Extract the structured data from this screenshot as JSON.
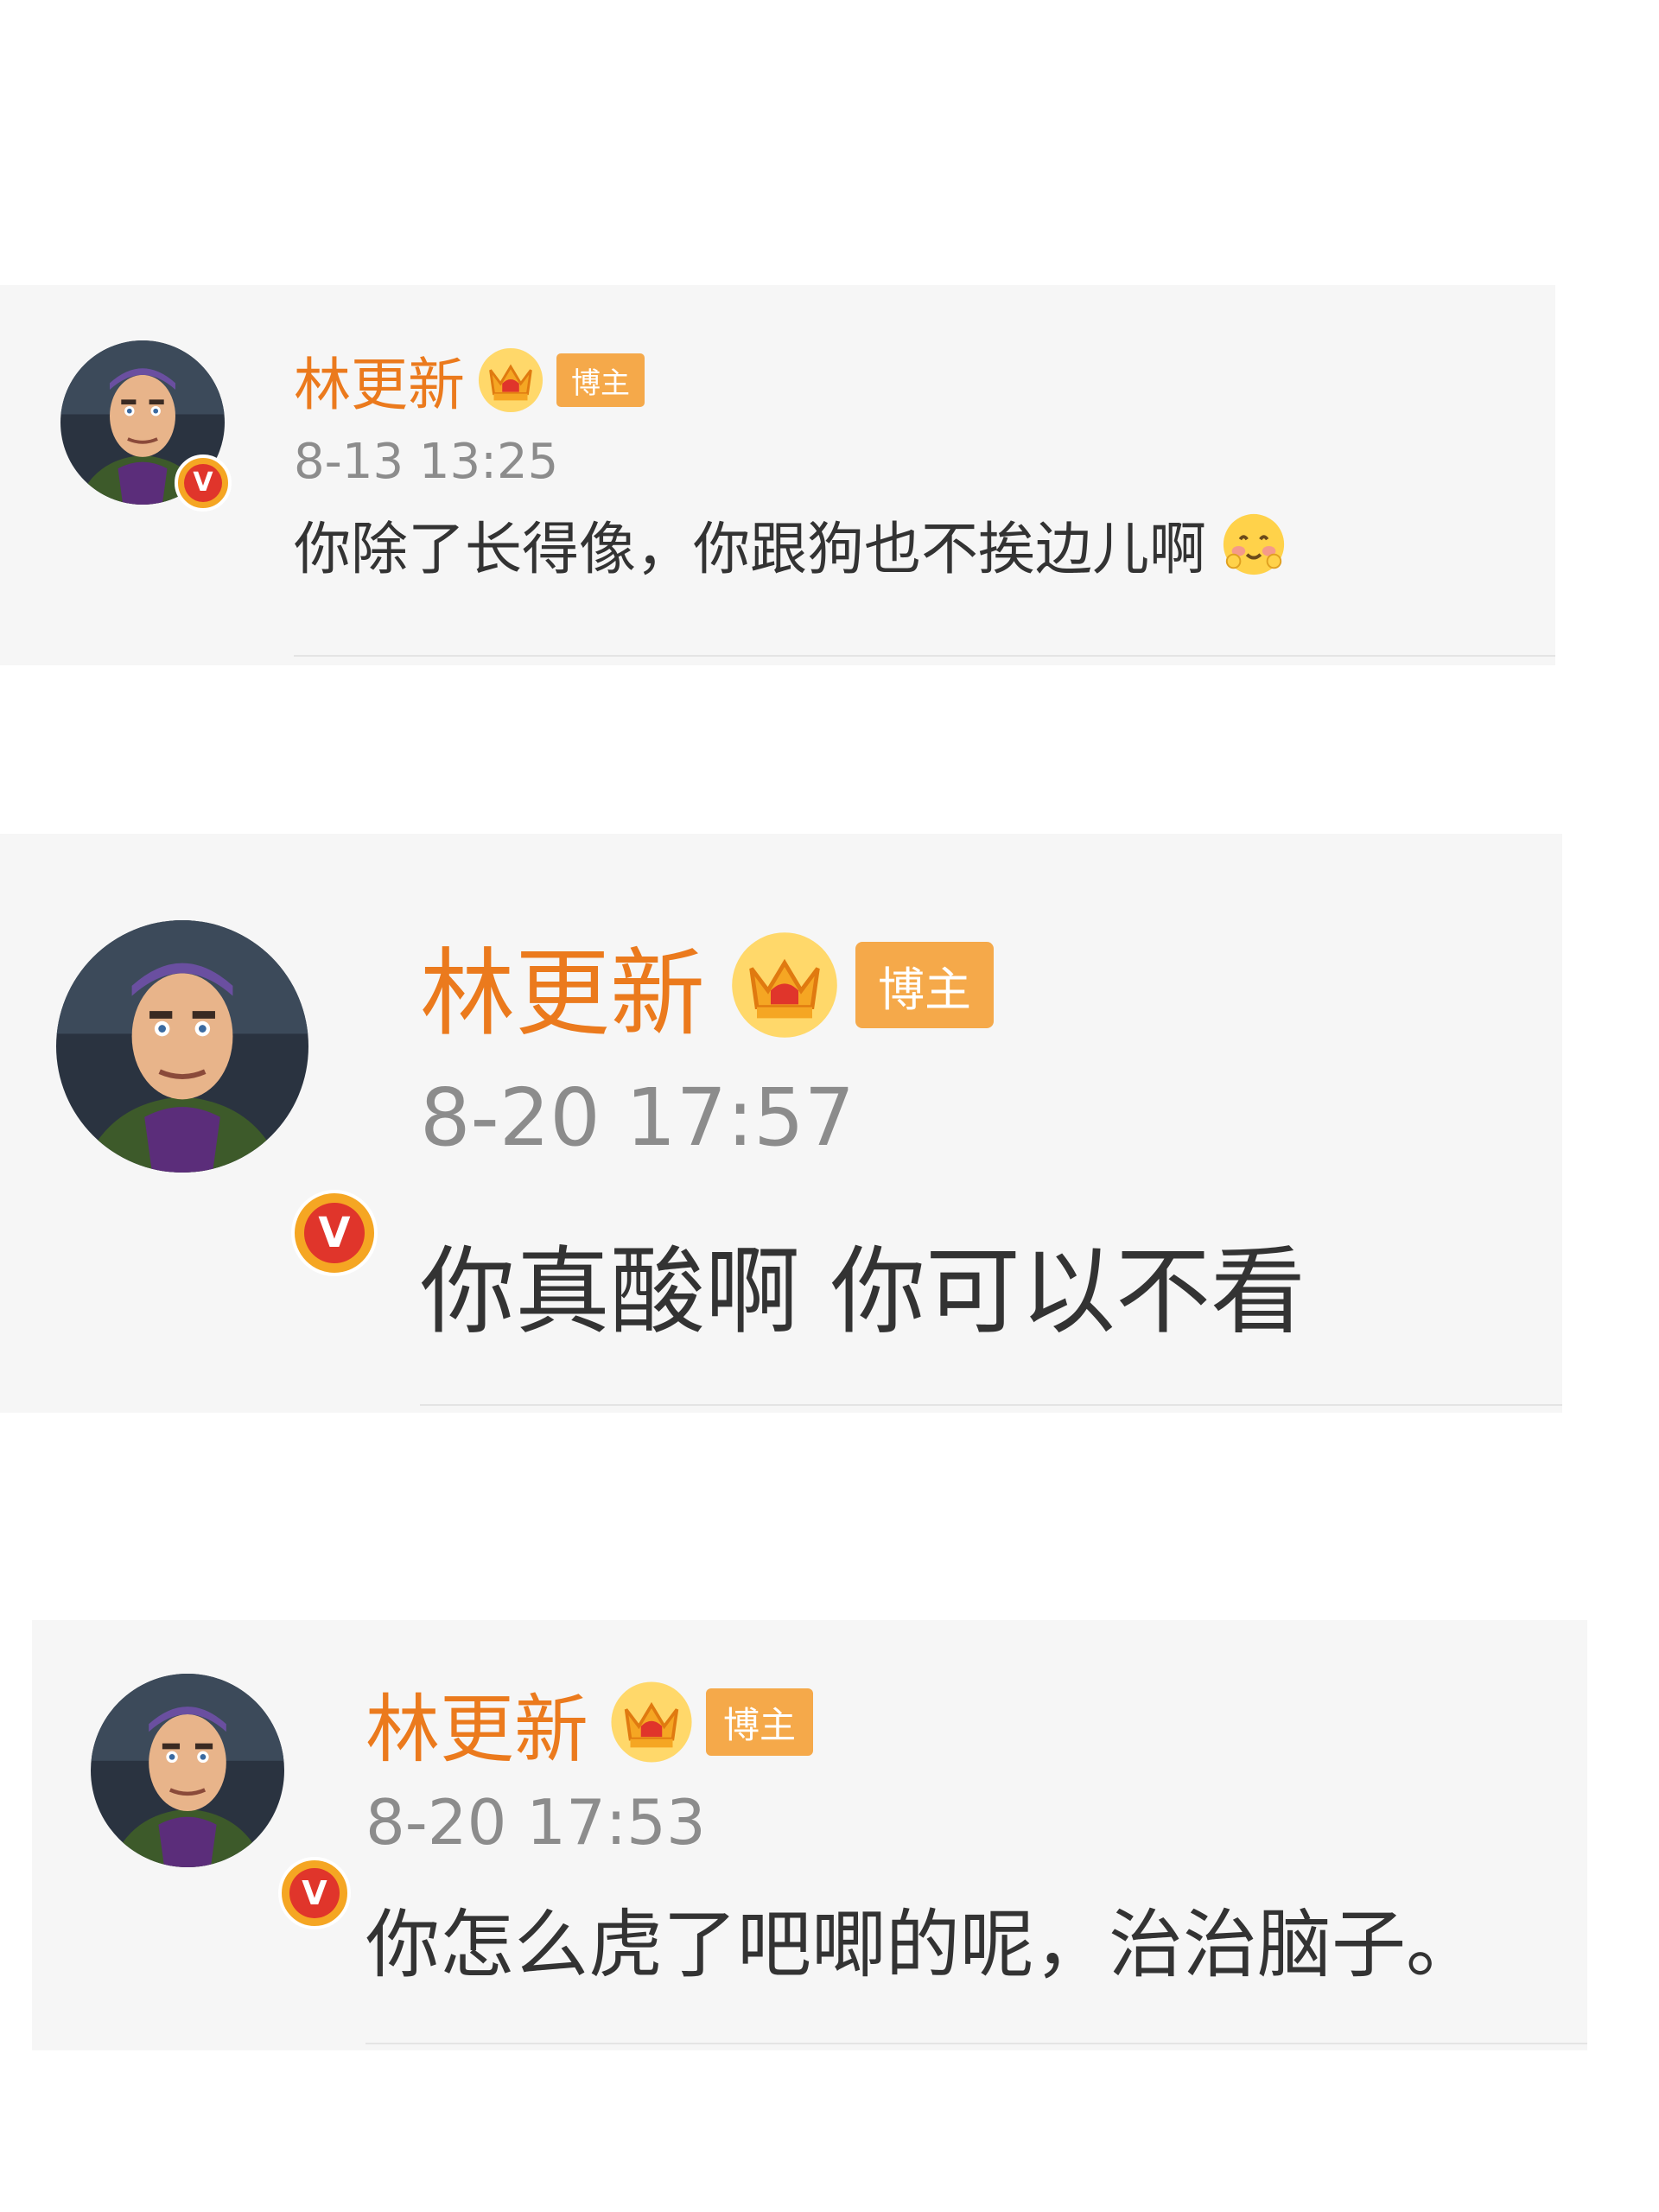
{
  "colors": {
    "card_background": "#f6f6f6",
    "username": "#eb7a1d",
    "tag_background": "#f5a94a",
    "timestamp": "#8c8c8c",
    "comment_text": "#333333",
    "verified_badge": "#e0352b"
  },
  "comments": [
    {
      "username": "林更新",
      "badge_icon": "crown-icon",
      "tag": "博主",
      "verified_mark": "V",
      "timestamp": "8-13 13:25",
      "text": "你除了长得像，你跟狗也不挨边儿啊",
      "emoji": "blushing-face-emoji"
    },
    {
      "username": "林更新",
      "badge_icon": "crown-icon",
      "tag": "博主",
      "verified_mark": "V",
      "timestamp": "8-20 17:57",
      "text": "你真酸啊 你可以不看"
    },
    {
      "username": "林更新",
      "badge_icon": "crown-icon",
      "tag": "博主",
      "verified_mark": "V",
      "timestamp": "8-20 17:53",
      "text": "你怎么虎了吧唧的呢，治治脑子。"
    }
  ]
}
